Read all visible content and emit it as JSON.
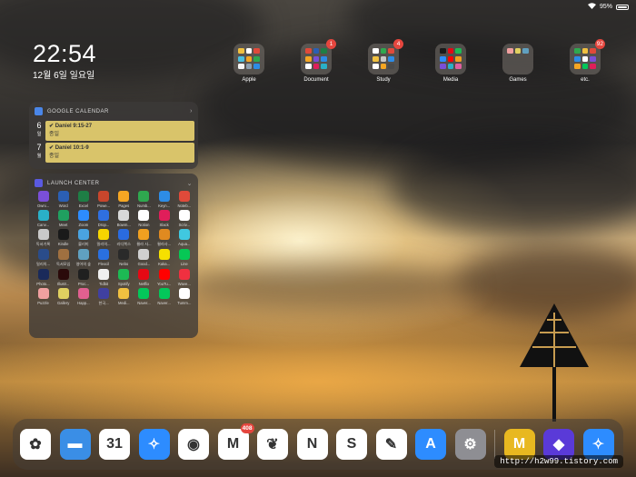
{
  "status": {
    "battery": "95%"
  },
  "lock": {
    "time": "22:54",
    "date": "12월 6일 일요일"
  },
  "folders": [
    {
      "name": "Apple",
      "badge": ""
    },
    {
      "name": "Document",
      "badge": "1"
    },
    {
      "name": "Study",
      "badge": "4"
    },
    {
      "name": "Media",
      "badge": ""
    },
    {
      "name": "Games",
      "badge": ""
    },
    {
      "name": "etc.",
      "badge": "92"
    }
  ],
  "calendar": {
    "title": "GOOGLE CALENDAR",
    "events": [
      {
        "day": "6",
        "weekday": "일",
        "title": "✔ Daniel 9:15-27",
        "sub": "종일"
      },
      {
        "day": "7",
        "weekday": "월",
        "title": "✔ Daniel 10:1-9",
        "sub": "종일"
      }
    ]
  },
  "launch": {
    "title": "LAUNCH CENTER",
    "apps": [
      "Owni...",
      "Word",
      "Excel",
      "Powe...",
      "Pages",
      "Numb...",
      "Keyn...",
      "Noteb...",
      "Canv...",
      "Meet",
      "Zoom",
      "Drop...",
      "Bowm...",
      "Notion",
      "Slack",
      "Scriv...",
      "독서기록",
      "Kindle",
      "블리미",
      "밀리의...",
      "리디북스",
      "윌라 사...",
      "윌라사...",
      "Aqua...",
      "밀리의...",
      "독서모임",
      "영어의 숲",
      "Flexcil",
      "Nebo",
      "Good...",
      "Kaka...",
      "Line",
      "Photo...",
      "Illustr...",
      "Proc...",
      "Tidbit",
      "Spotify",
      "Netflix",
      "YouTu...",
      "Wave...",
      "Puzzle",
      "Gallery",
      "Happ...",
      "한국...",
      "Medi...",
      "Naver...",
      "Naver...",
      "Tumm..."
    ],
    "colors": [
      "#7a4fd8",
      "#2b5fb4",
      "#1e7e45",
      "#c8462c",
      "#f5a623",
      "#2fa84f",
      "#2d8ce6",
      "#e04a3a",
      "#2ab0c8",
      "#20a060",
      "#2d8cff",
      "#2f6fe0",
      "#d8d8d8",
      "#ffffff",
      "#e01e5a",
      "#ffffff",
      "#c9c9c9",
      "#1a1a1a",
      "#4aa3e0",
      "#f6d500",
      "#2a6be0",
      "#f0a020",
      "#e08a20",
      "#40c8e0",
      "#2a4c8a",
      "#a07040",
      "#60a0c0",
      "#2a70e0",
      "#2a2a2a",
      "#d0d0d0",
      "#f6e000",
      "#06c755",
      "#1a2a5a",
      "#2a0a0a",
      "#202020",
      "#f0f0f0",
      "#1db954",
      "#e50914",
      "#ff0000",
      "#f03040",
      "#f0a0a0",
      "#e0d060",
      "#e06090",
      "#4040a0",
      "#f0c040",
      "#03c75a",
      "#03c75a",
      "#ffffff"
    ]
  },
  "dock": {
    "apps": [
      {
        "name": "photos-app",
        "color": "#ffffff",
        "glyph": "✿",
        "badge": ""
      },
      {
        "name": "files-app",
        "color": "#3a8ee6",
        "glyph": "▬",
        "badge": ""
      },
      {
        "name": "google-calendar-app",
        "color": "#ffffff",
        "glyph": "31",
        "badge": ""
      },
      {
        "name": "safari-app",
        "color": "#2d8cff",
        "glyph": "✧",
        "badge": ""
      },
      {
        "name": "chrome-app",
        "color": "#ffffff",
        "glyph": "◉",
        "badge": ""
      },
      {
        "name": "gmail-app",
        "color": "#ffffff",
        "glyph": "M",
        "badge": "408"
      },
      {
        "name": "evernote-app",
        "color": "#ffffff",
        "glyph": "❦",
        "badge": ""
      },
      {
        "name": "notion-app",
        "color": "#ffffff",
        "glyph": "N",
        "badge": ""
      },
      {
        "name": "scrivener-app",
        "color": "#ffffff",
        "glyph": "S",
        "badge": ""
      },
      {
        "name": "goodnotes-app",
        "color": "#ffffff",
        "glyph": "✎",
        "badge": ""
      },
      {
        "name": "app-store-app",
        "color": "#2d8cff",
        "glyph": "A",
        "badge": ""
      },
      {
        "name": "settings-app",
        "color": "#8e8e93",
        "glyph": "⚙",
        "badge": ""
      },
      {
        "name": "klar-app",
        "color": "#e8b820",
        "glyph": "M",
        "badge": ""
      },
      {
        "name": "shortcuts-app",
        "color": "#5a3ad8",
        "glyph": "◆",
        "badge": ""
      },
      {
        "name": "safari-recent-app",
        "color": "#2d8cff",
        "glyph": "✧",
        "badge": ""
      }
    ]
  },
  "watermark": "http://h2w99.tistory.com"
}
